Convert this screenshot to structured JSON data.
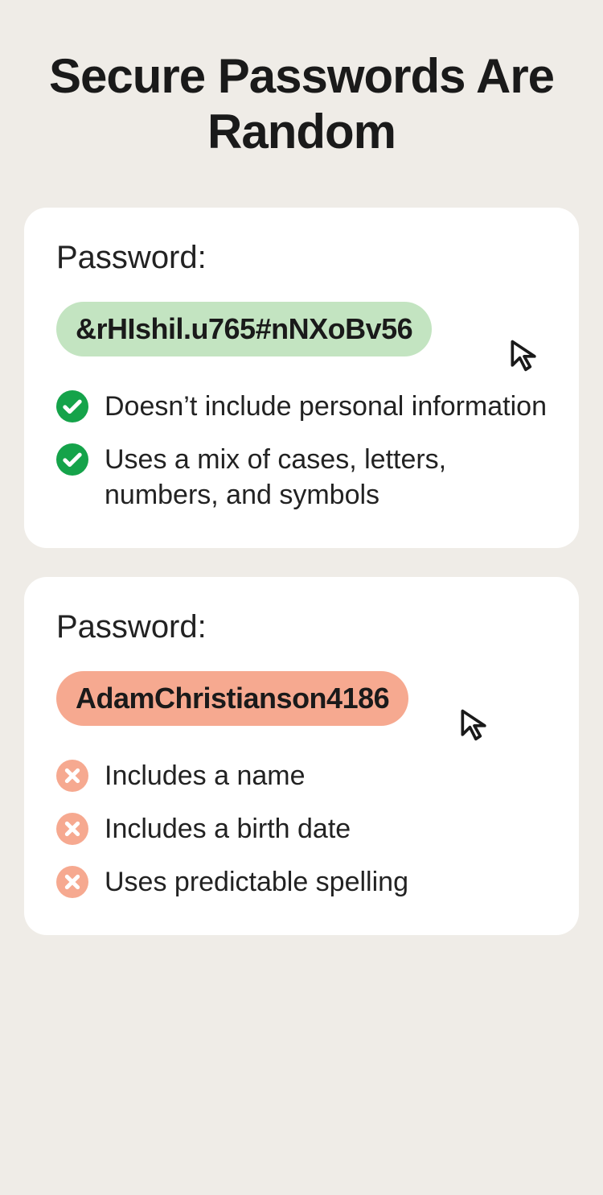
{
  "title": "Secure Passwords Are Random",
  "good": {
    "label": "Password:",
    "password": "&rHIshil.u765#nNXoBv56",
    "points": [
      "Doesn’t include personal information",
      "Uses a mix of cases, letters, numbers, and symbols"
    ]
  },
  "bad": {
    "label": "Password:",
    "password": "AdamChristianson4186",
    "points": [
      "Includes a name",
      "Includes a birth date",
      "Uses predictable spelling"
    ]
  }
}
